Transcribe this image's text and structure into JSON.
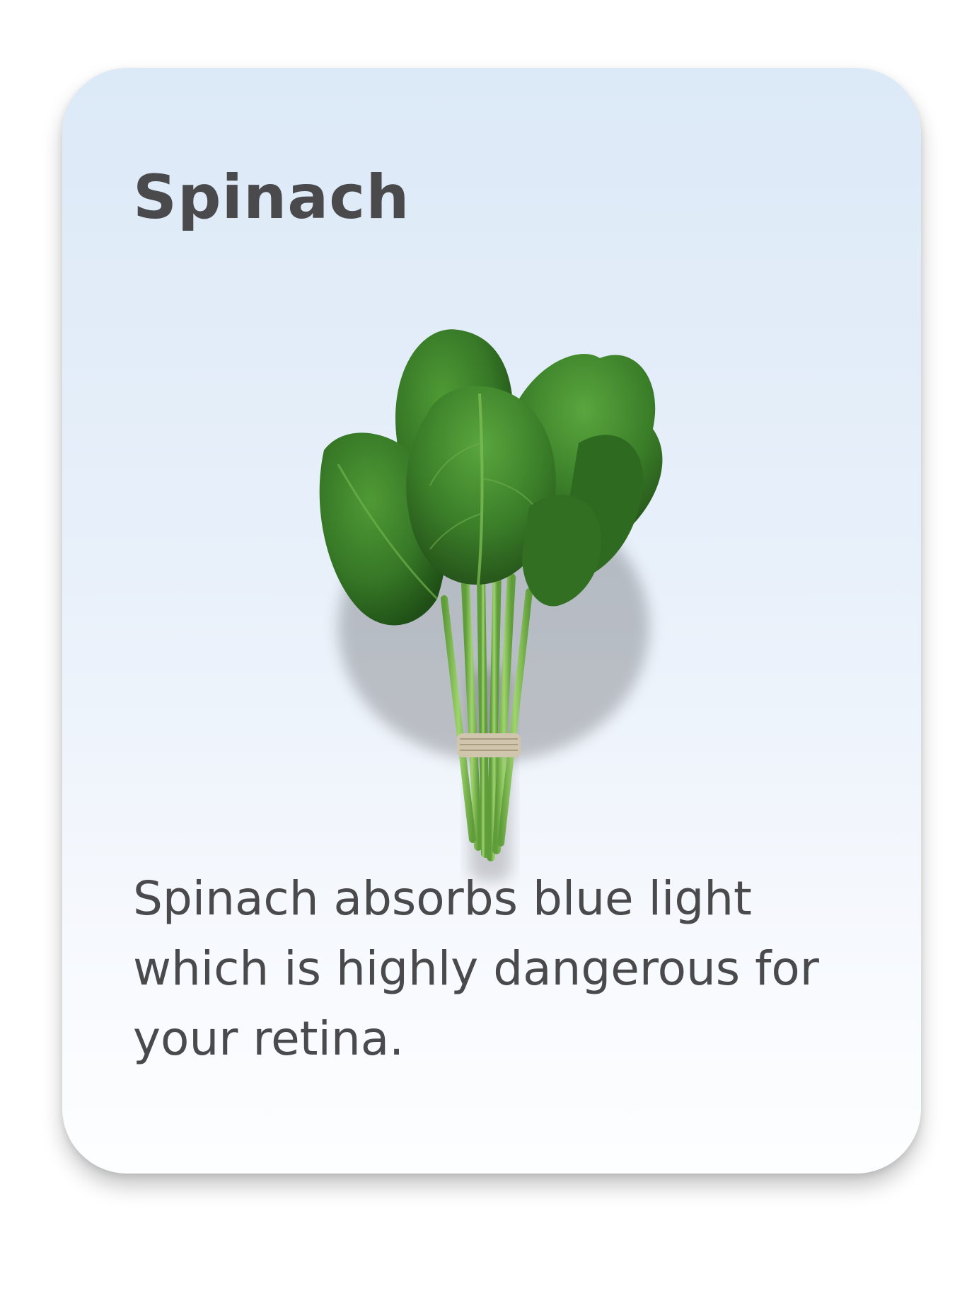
{
  "card": {
    "title": "Spinach",
    "image_icon": "spinach-bunch-illustration",
    "fact": "Spinach absorbs blue light which is highly dangerous for your retina."
  },
  "colors": {
    "text": "#4a4a4c",
    "card_gradient_top": "#dce9f7",
    "card_gradient_bottom": "#fdfeff",
    "leaf_dark": "#2f6b1f",
    "leaf_mid": "#3f8a2b",
    "stem": "#86c15a",
    "twine": "#c9bfa6"
  }
}
